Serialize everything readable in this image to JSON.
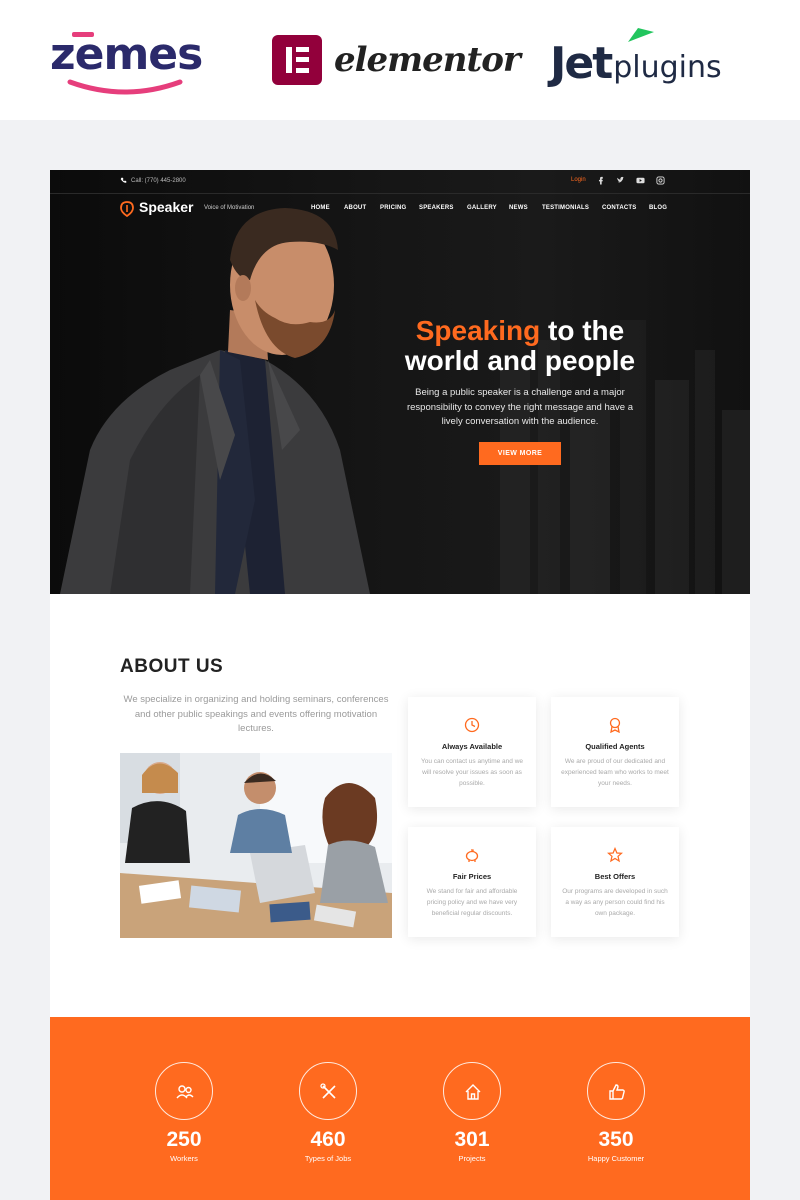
{
  "brands": {
    "zemes": "zemes",
    "elementor": "elementor",
    "jet_main": "Jet",
    "jet_sub": "plugins"
  },
  "topbar": {
    "phone": "Call: (770) 445-2800",
    "login": "Login",
    "social": [
      "facebook-icon",
      "twitter-icon",
      "youtube-icon",
      "instagram-icon"
    ]
  },
  "header": {
    "logo": "Speaker",
    "tagline": "Voice of Motivation",
    "nav": [
      "HOME",
      "ABOUT",
      "PRICING",
      "SPEAKERS",
      "GALLERY",
      "NEWS",
      "TESTIMONIALS",
      "CONTACTS",
      "BLOG"
    ]
  },
  "hero": {
    "title_accent": "Speaking",
    "title_rest1": " to the",
    "title_line2": "world and people",
    "desc": "Being a public speaker is a challenge and a major responsibility to convey the right message and have a lively conversation with the audience.",
    "button": "VIEW MORE"
  },
  "about": {
    "title": "ABOUT US",
    "text": "We specialize in organizing and holding seminars, conferences and other public speakings and events offering motivation lectures.",
    "cards": [
      {
        "icon": "clock-icon",
        "title": "Always Available",
        "desc": "You can contact us anytime and we will resolve your issues as soon as possible."
      },
      {
        "icon": "award-icon",
        "title": "Qualified Agents",
        "desc": "We are proud of our dedicated and experienced team who works to meet your needs."
      },
      {
        "icon": "piggy-bank-icon",
        "title": "Fair Prices",
        "desc": "We stand for fair and affordable pricing policy and we have very beneficial regular discounts."
      },
      {
        "icon": "star-icon",
        "title": "Best Offers",
        "desc": "Our programs are developed in such a way as any person could find his own package."
      }
    ]
  },
  "stats": [
    {
      "icon": "workers-icon",
      "value": "250",
      "label": "Workers"
    },
    {
      "icon": "tools-icon",
      "value": "460",
      "label": "Types of Jobs"
    },
    {
      "icon": "house-icon",
      "value": "301",
      "label": "Projects"
    },
    {
      "icon": "thumbs-up-icon",
      "value": "350",
      "label": "Happy Customer"
    }
  ],
  "colors": {
    "accent": "#ff6a1f",
    "dark": "#111111",
    "zemes_navy": "#2b2a6b",
    "zemes_pink": "#e63e7c",
    "elementor_red": "#92003b",
    "jet_green": "#22c55e"
  }
}
